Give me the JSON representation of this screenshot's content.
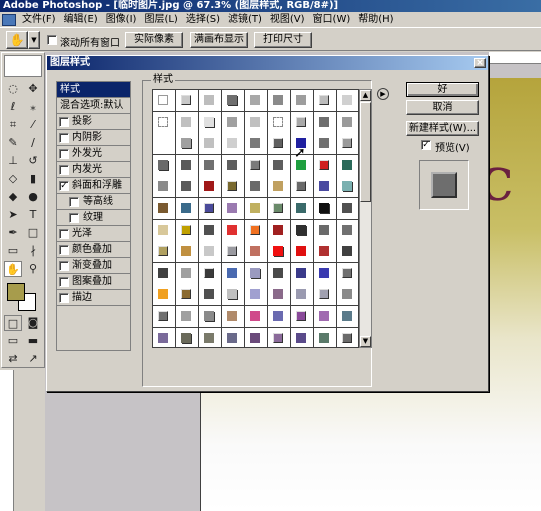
{
  "window": {
    "title": "Adobe Photoshop - [临时图片.jpg @ 67.3% (图层样式, RGB/8#)]"
  },
  "menu": [
    "文件(F)",
    "编辑(E)",
    "图像(I)",
    "图层(L)",
    "选择(S)",
    "滤镜(T)",
    "视图(V)",
    "窗口(W)",
    "帮助(H)"
  ],
  "options": {
    "scroll_all_label": "滚动所有窗口",
    "actual_pixels": "实际像素",
    "fit_screen": "满画布显示",
    "print_size": "打印尺寸"
  },
  "colors": {
    "foreground": "#a79c4c",
    "background": "#ffffff"
  },
  "dialog": {
    "title": "图层样式",
    "close_glyph": "×",
    "styles_group": "样式",
    "left_items": [
      {
        "label": "样式",
        "checkbox": false,
        "checked": false,
        "selected": true
      },
      {
        "label": "混合选项:默认",
        "checkbox": false,
        "checked": false,
        "selected": false
      },
      {
        "label": "投影",
        "checkbox": true,
        "checked": false,
        "selected": false
      },
      {
        "label": "内阴影",
        "checkbox": true,
        "checked": false,
        "selected": false
      },
      {
        "label": "外发光",
        "checkbox": true,
        "checked": false,
        "selected": false
      },
      {
        "label": "内发光",
        "checkbox": true,
        "checked": false,
        "selected": false
      },
      {
        "label": "斜面和浮雕",
        "checkbox": true,
        "checked": true,
        "selected": false
      },
      {
        "label": "等高线",
        "checkbox": true,
        "checked": false,
        "selected": false,
        "indent": true
      },
      {
        "label": "纹理",
        "checkbox": true,
        "checked": false,
        "selected": false,
        "indent": true
      },
      {
        "label": "光泽",
        "checkbox": true,
        "checked": false,
        "selected": false
      },
      {
        "label": "颜色叠加",
        "checkbox": true,
        "checked": false,
        "selected": false
      },
      {
        "label": "渐变叠加",
        "checkbox": true,
        "checked": false,
        "selected": false
      },
      {
        "label": "图案叠加",
        "checkbox": true,
        "checked": false,
        "selected": false
      },
      {
        "label": "描边",
        "checkbox": true,
        "checked": false,
        "selected": false
      }
    ],
    "ok": "好",
    "cancel": "取消",
    "new_style": "新建样式(W)...",
    "preview_label": "预览(V)",
    "preview_checked": true,
    "swatches": [
      [
        "#ffffff",
        "#c8c8c8",
        "#bdbdbd",
        "#6f6f6f",
        "#a8a8a8",
        "#8a8a8a",
        "#9d9d9d",
        "#bcbcbc",
        "#d0d0d0"
      ],
      [
        "#ffffff",
        "#c0c0c0",
        "#e0e0e0",
        "#a0a0a0",
        "#c0c0c0",
        "#ffffff",
        "#a9a9a9",
        "#6e6e6e",
        "#9a9a9a"
      ],
      [
        "#ffffff",
        "#a0a0a0",
        "#c0c0c0",
        "#cfcfcf",
        "#7a7a7a",
        "#606060",
        "#2020a0",
        "#707070",
        "#9a9a9a"
      ],
      [
        "#6a6a6a",
        "#5a5a5a",
        "#707070",
        "#5e5e5e",
        "#7a7a7a",
        "#5e5e5e",
        "#1f9f3f",
        "#d02020",
        "#2a6a5a"
      ],
      [
        "#8a8a8a",
        "#5a5a5a",
        "#a01818",
        "#7a6a30",
        "#6a6a6a",
        "#c0a060",
        "#6a6a6a",
        "#4a4aa0",
        "#7ab0b0"
      ],
      [
        "#7a5a30",
        "#3a6a8a",
        "#4a4a9a",
        "#9a7ab0",
        "#c0b060",
        "#6a8a6a",
        "#3a6a6a",
        "#101010",
        "#505050"
      ],
      [
        "#d8c89a",
        "#c0a000",
        "#505050",
        "#e03030",
        "#f07020",
        "#a02020",
        "#303030",
        "#6a6a6a",
        "#707070"
      ],
      [
        "#b0a060",
        "#c09040",
        "#c8c8c8",
        "#9a9aa0",
        "#c07060",
        "#f01010",
        "#e01010",
        "#b03030",
        "#404040"
      ],
      [
        "#404040",
        "#a0a0a0",
        "#3a3a3a",
        "#4a6ab0",
        "#9a9ac0",
        "#4a4a4a",
        "#3a3a8a",
        "#3a3ab0",
        "#707070"
      ],
      [
        "#f0a020",
        "#8a6a30",
        "#505050",
        "#c0c0c0",
        "#a0a0d0",
        "#8a6a8a",
        "#9a9ab0",
        "#a0a0b0",
        "#8a8a8a"
      ],
      [
        "#707070",
        "#a0a0a0",
        "#8a8a8a",
        "#b08a6a",
        "#d04a8a",
        "#6a6ab0",
        "#8a4a9a",
        "#a06ab0",
        "#5a7a8a"
      ],
      [
        "#7a6a9a",
        "#6a6a5a",
        "#7a7a6a",
        "#6a6a8a",
        "#6a4a7a",
        "#8a6a9a",
        "#5a4a8a",
        "#5a7a6a",
        "#6a6a6a"
      ]
    ]
  }
}
